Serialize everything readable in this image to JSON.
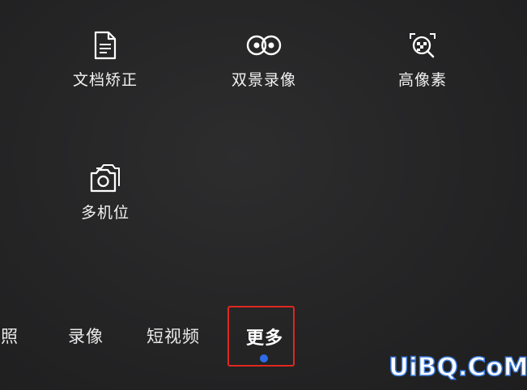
{
  "modes": [
    {
      "label": "文档矫正",
      "icon": "document-icon"
    },
    {
      "label": "双景录像",
      "icon": "dual-view-icon"
    },
    {
      "label": "高像素",
      "icon": "high-pixel-icon"
    },
    {
      "label": "多机位",
      "icon": "multi-camera-icon"
    }
  ],
  "tabs": {
    "photo": "拍照",
    "video": "录像",
    "short_video": "短视频",
    "more": "更多"
  },
  "active_tab": "more",
  "colors": {
    "active_dot": "#2f6bea",
    "highlight_box": "#e0281f",
    "watermark_stroke": "#3b7ad9"
  },
  "watermark": "UiBQ.CoM"
}
